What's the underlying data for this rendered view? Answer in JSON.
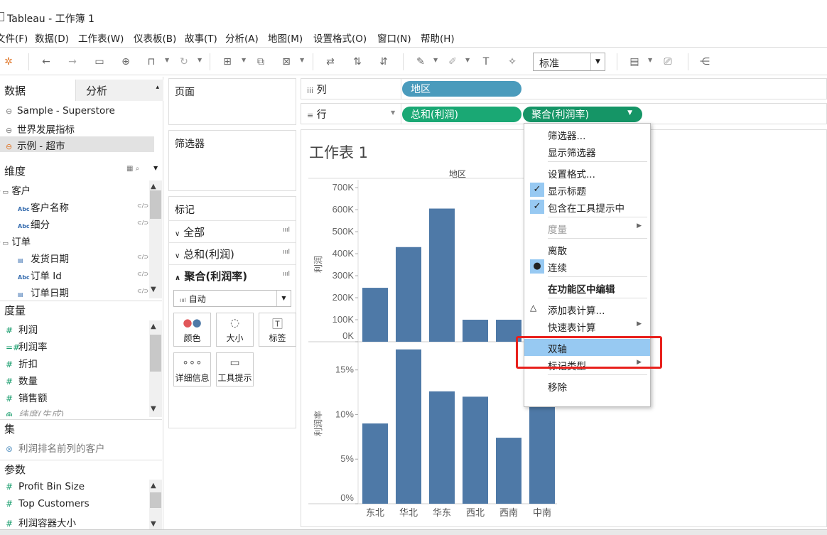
{
  "window": {
    "title": "Tableau - 工作簿 1"
  },
  "menubar": [
    "文件(F)",
    "数据(D)",
    "工作表(W)",
    "仪表板(B)",
    "故事(T)",
    "分析(A)",
    "地图(M)",
    "设置格式(O)",
    "窗口(N)",
    "帮助(H)"
  ],
  "toolbar": {
    "fit_select": "标准"
  },
  "left_pane": {
    "tab_data": "数据",
    "tab_analytics": "分析",
    "datasources": [
      "Sample - Superstore",
      "世界发展指标",
      "示例 - 超市"
    ],
    "dimensions_header": "维度",
    "dimensions": [
      {
        "label": "客户",
        "type": "folder"
      },
      {
        "label": "客户名称",
        "type": "Abc"
      },
      {
        "label": "细分",
        "type": "Abc"
      },
      {
        "label": "订单",
        "type": "folder"
      },
      {
        "label": "发货日期",
        "type": "date"
      },
      {
        "label": "订单 Id",
        "type": "Abc"
      },
      {
        "label": "订单日期",
        "type": "date"
      }
    ],
    "measures_header": "度量",
    "measures": [
      "利润",
      "利润率",
      "折扣",
      "数量",
      "销售额",
      "纬度(生成)"
    ],
    "sets_header": "集",
    "sets": [
      "利润排名前列的客户"
    ],
    "params_header": "参数",
    "params": [
      "Profit Bin Size",
      "Top Customers",
      "利润容器大小"
    ]
  },
  "cards": {
    "pages": "页面",
    "filters": "筛选器",
    "marks": "标记",
    "marks_rows": [
      "全部",
      "总和(利润)",
      "聚合(利润率)"
    ],
    "mark_type": "自动",
    "mark_buttons": [
      "颜色",
      "大小",
      "标签",
      "详细信息",
      "工具提示"
    ]
  },
  "shelves": {
    "columns_label": "列",
    "rows_label": "行",
    "columns_pills": [
      "地区"
    ],
    "rows_pills": [
      "总和(利润)",
      "聚合(利润率)"
    ]
  },
  "sheet": {
    "title": "工作表 1"
  },
  "chart_data": {
    "type": "bar",
    "header": "地区",
    "categories": [
      "东北",
      "华北",
      "华东",
      "西北",
      "西南",
      "中南"
    ],
    "series": [
      {
        "name": "利润",
        "values": [
          245000,
          430000,
          605000,
          100000,
          100000,
          null
        ],
        "yticks": [
          "0K",
          "100K",
          "200K",
          "300K",
          "400K",
          "500K",
          "600K",
          "700K"
        ],
        "ylim": [
          0,
          700000
        ]
      },
      {
        "name": "利润率",
        "values": [
          0.09,
          0.173,
          0.126,
          0.12,
          0.074,
          0.17
        ],
        "yticks": [
          "0%",
          "5%",
          "10%",
          "15%"
        ],
        "ylim": [
          0,
          0.18
        ]
      }
    ],
    "bar_color": "#4e79a7"
  },
  "context_menu": {
    "items": [
      {
        "label": "筛选器...",
        "checked": false
      },
      {
        "label": "显示筛选器",
        "checked": false
      },
      {
        "sep": true
      },
      {
        "label": "设置格式...",
        "checked": false
      },
      {
        "label": "显示标题",
        "checked": true
      },
      {
        "label": "包含在工具提示中",
        "checked": true
      },
      {
        "sep": true
      },
      {
        "label": "度量",
        "checked": false,
        "submenu": true,
        "disabled": true
      },
      {
        "sep": true
      },
      {
        "label": "离散",
        "checked": false
      },
      {
        "label": "连续",
        "dot": true
      },
      {
        "sep": true
      },
      {
        "label": "在功能区中编辑",
        "bold": true
      },
      {
        "sep": true
      },
      {
        "label": "添加表计算...",
        "delta": true
      },
      {
        "label": "快速表计算",
        "submenu": true
      },
      {
        "sep": true
      },
      {
        "label": "双轴",
        "highlight": true
      },
      {
        "label": "标记类型",
        "submenu": true
      },
      {
        "sep": true
      },
      {
        "label": "移除"
      }
    ]
  },
  "colors": {
    "dim_pill": "#4a9bbc",
    "measure_pill": "#1aa874",
    "bar": "#4e79a7",
    "highlight": "#97c9f2",
    "annotation": "#e8201c"
  }
}
